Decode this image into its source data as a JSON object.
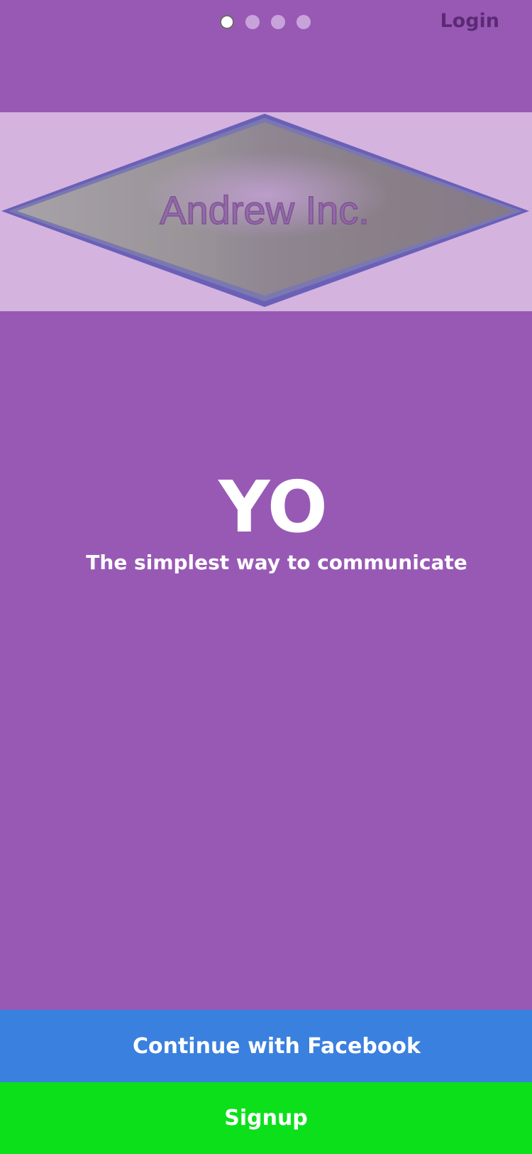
{
  "header": {
    "login_label": "Login",
    "pagination": {
      "total": 4,
      "active": 1
    }
  },
  "banner": {
    "logo_text": "Andrew Inc.",
    "icon": "diamond-logo"
  },
  "main": {
    "title": "YO",
    "tagline": "The simplest way to communicate"
  },
  "actions": {
    "facebook_label": "Continue with Facebook",
    "signup_label": "Signup"
  },
  "colors": {
    "background": "#9859b5",
    "banner": "#d4b3df",
    "facebook": "#3a80df",
    "signup": "#0be01b",
    "login_text": "#5c2a73"
  }
}
